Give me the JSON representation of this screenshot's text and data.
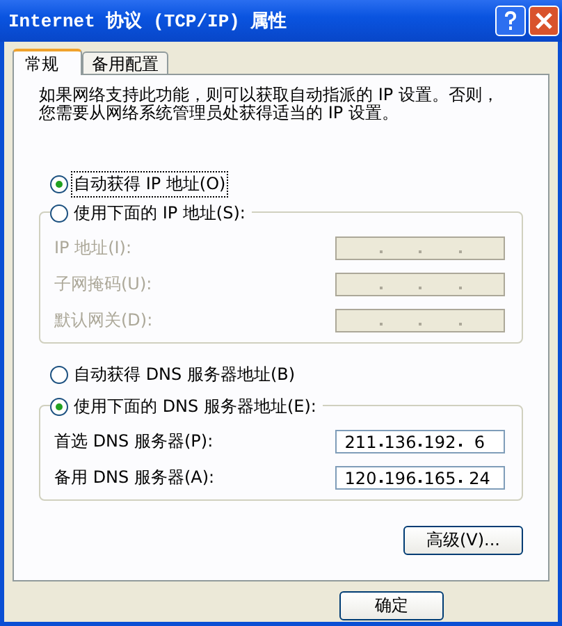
{
  "window": {
    "title": "Internet 协议 (TCP/IP) 属性"
  },
  "tabs": [
    {
      "label": "常规",
      "selected": true
    },
    {
      "label": "备用配置",
      "selected": false
    }
  ],
  "description": [
    "如果网络支持此功能，则可以获取自动指派的 IP 设置。否则，",
    "您需要从网络系统管理员处获得适当的 IP 设置。"
  ],
  "ip_section": {
    "auto_option": {
      "label": "自动获得 IP 地址(O)",
      "selected": true
    },
    "manual_option": {
      "label": "使用下面的 IP 地址(S):",
      "selected": false
    },
    "fields": [
      {
        "label": "IP 地址(I):",
        "disabled": true
      },
      {
        "label": "子网掩码(U):",
        "disabled": true
      },
      {
        "label": "默认网关(D):",
        "disabled": true
      }
    ]
  },
  "dns_section": {
    "auto_option": {
      "label": "自动获得 DNS 服务器地址(B)",
      "selected": false
    },
    "manual_option": {
      "label": "使用下面的 DNS 服务器地址(E):",
      "selected": true
    },
    "fields": [
      {
        "label": "首选 DNS 服务器(P):",
        "disabled": false,
        "octets": [
          "211",
          "136",
          "192",
          "6"
        ]
      },
      {
        "label": "备用 DNS 服务器(A):",
        "disabled": false,
        "octets": [
          "120",
          "196",
          "165",
          "24"
        ]
      }
    ]
  },
  "advanced_button": "高级(V)...",
  "buttons": [
    "确定"
  ]
}
